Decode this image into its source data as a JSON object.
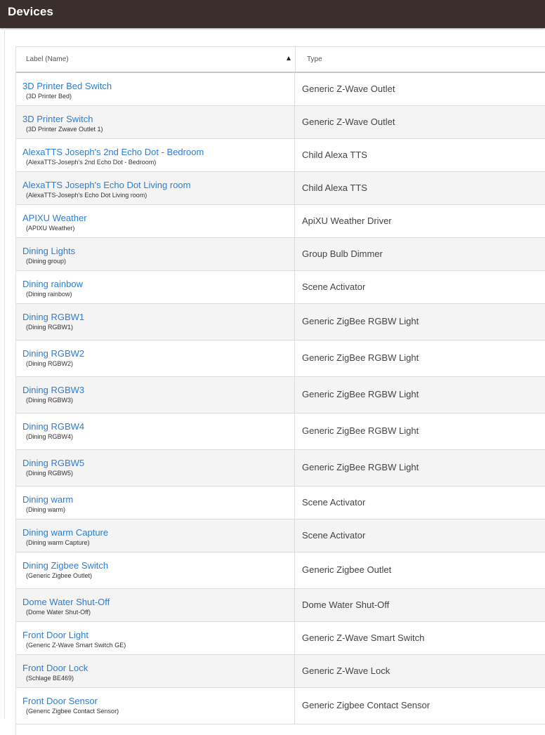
{
  "header": {
    "title": "Devices"
  },
  "table": {
    "columns": {
      "label": "Label (Name)",
      "type": "Type"
    },
    "sort": {
      "column": "label",
      "direction": "ascending"
    },
    "rows": [
      {
        "label": "3D Printer Bed Switch",
        "name": "(3D Printer Bed)",
        "type": "Generic Z-Wave Outlet"
      },
      {
        "label": "3D Printer Switch",
        "name": "(3D Printer Zwave Outlet 1)",
        "type": "Generic Z-Wave Outlet"
      },
      {
        "label": "AlexaTTS Joseph's 2nd Echo Dot - Bedroom",
        "name": "(AlexaTTS-Joseph's 2nd Echo Dot - Bedroom)",
        "type": "Child Alexa TTS"
      },
      {
        "label": "AlexaTTS Joseph's Echo Dot Living room",
        "name": "(AlexaTTS-Joseph's Echo Dot Living room)",
        "type": "Child Alexa TTS"
      },
      {
        "label": "APIXU Weather",
        "name": "(APIXU Weather)",
        "type": "ApiXU Weather Driver"
      },
      {
        "label": "Dining Lights",
        "name": "(Dining group)",
        "type": "Group Bulb Dimmer"
      },
      {
        "label": "Dining rainbow",
        "name": "(Dining rainbow)",
        "type": "Scene Activator"
      },
      {
        "label": "Dining RGBW1",
        "name": "(Dining RGBW1)",
        "type": "Generic ZigBee RGBW Light"
      },
      {
        "label": "Dining RGBW2",
        "name": "(Dining RGBW2)",
        "type": "Generic ZigBee RGBW Light"
      },
      {
        "label": "Dining RGBW3",
        "name": "(Dining RGBW3)",
        "type": "Generic ZigBee RGBW Light"
      },
      {
        "label": "Dining RGBW4",
        "name": "(Dining RGBW4)",
        "type": "Generic ZigBee RGBW Light"
      },
      {
        "label": "Dining RGBW5",
        "name": "(Dining RGBW5)",
        "type": "Generic ZigBee RGBW Light"
      },
      {
        "label": "Dining warm",
        "name": "(Dining warm)",
        "type": "Scene Activator"
      },
      {
        "label": "Dining warm Capture",
        "name": "(Dining warm Capture)",
        "type": "Scene Activator"
      },
      {
        "label": "Dining Zigbee Switch",
        "name": "(Generic Zigbee Outlet)",
        "type": "Generic Zigbee Outlet"
      },
      {
        "label": "Dome Water Shut-Off",
        "name": "(Dome Water Shut-Off)",
        "type": "Dome Water Shut-Off"
      },
      {
        "label": "Front Door Light",
        "name": "(Generic Z-Wave Smart Switch GE)",
        "type": "Generic Z-Wave Smart Switch"
      },
      {
        "label": "Front Door Lock",
        "name": "(Schlage BE469)",
        "type": "Generic Z-Wave Lock"
      },
      {
        "label": "Front Door Sensor",
        "name": "(Generic Zigbee Contact Sensor)",
        "type": "Generic Zigbee Contact Sensor"
      }
    ]
  },
  "colors": {
    "header_bg": "#3a2f2b",
    "link": "#2d7dd2",
    "alt_row": "#f4f4f4"
  },
  "icons": {
    "sort": "sort-ascending-icon"
  }
}
